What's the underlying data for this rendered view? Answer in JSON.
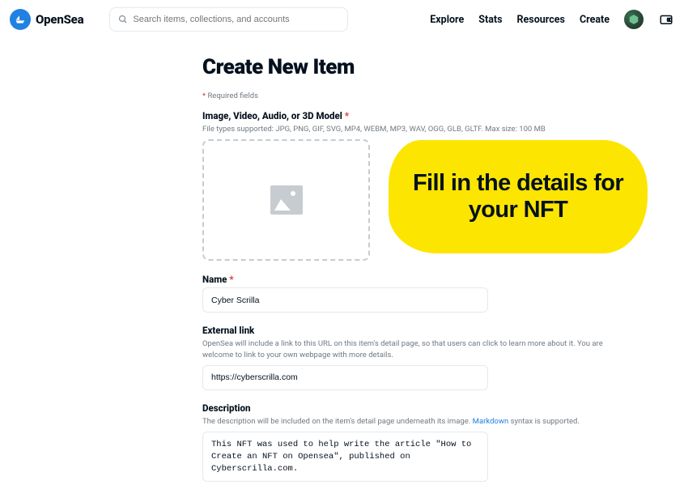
{
  "header": {
    "brand": "OpenSea",
    "search_placeholder": "Search items, collections, and accounts",
    "nav": {
      "explore": "Explore",
      "stats": "Stats",
      "resources": "Resources",
      "create": "Create"
    }
  },
  "page": {
    "title": "Create New Item",
    "required_note_star": "*",
    "required_note": " Required fields"
  },
  "media": {
    "label": "Image, Video, Audio, or 3D Model ",
    "star": "*",
    "help": "File types supported: JPG, PNG, GIF, SVG, MP4, WEBM, MP3, WAV, OGG, GLB, GLTF. Max size: 100 MB"
  },
  "name": {
    "label": "Name ",
    "star": "*",
    "value": "Cyber Scrilla"
  },
  "external": {
    "label": "External link",
    "help": "OpenSea will include a link to this URL on this item's detail page, so that users can click to learn more about it. You are welcome to link to your own webpage with more details.",
    "value": "https://cyberscrilla.com"
  },
  "description": {
    "label": "Description",
    "help_pre": "The description will be included on the item's detail page underneath its image. ",
    "help_link": "Markdown",
    "help_post": " syntax is supported.",
    "value": "This NFT was used to help write the article \"How to Create an NFT on Opensea\", published on Cyberscrilla.com."
  },
  "annotation": {
    "text": "Fill in the details for your NFT"
  }
}
